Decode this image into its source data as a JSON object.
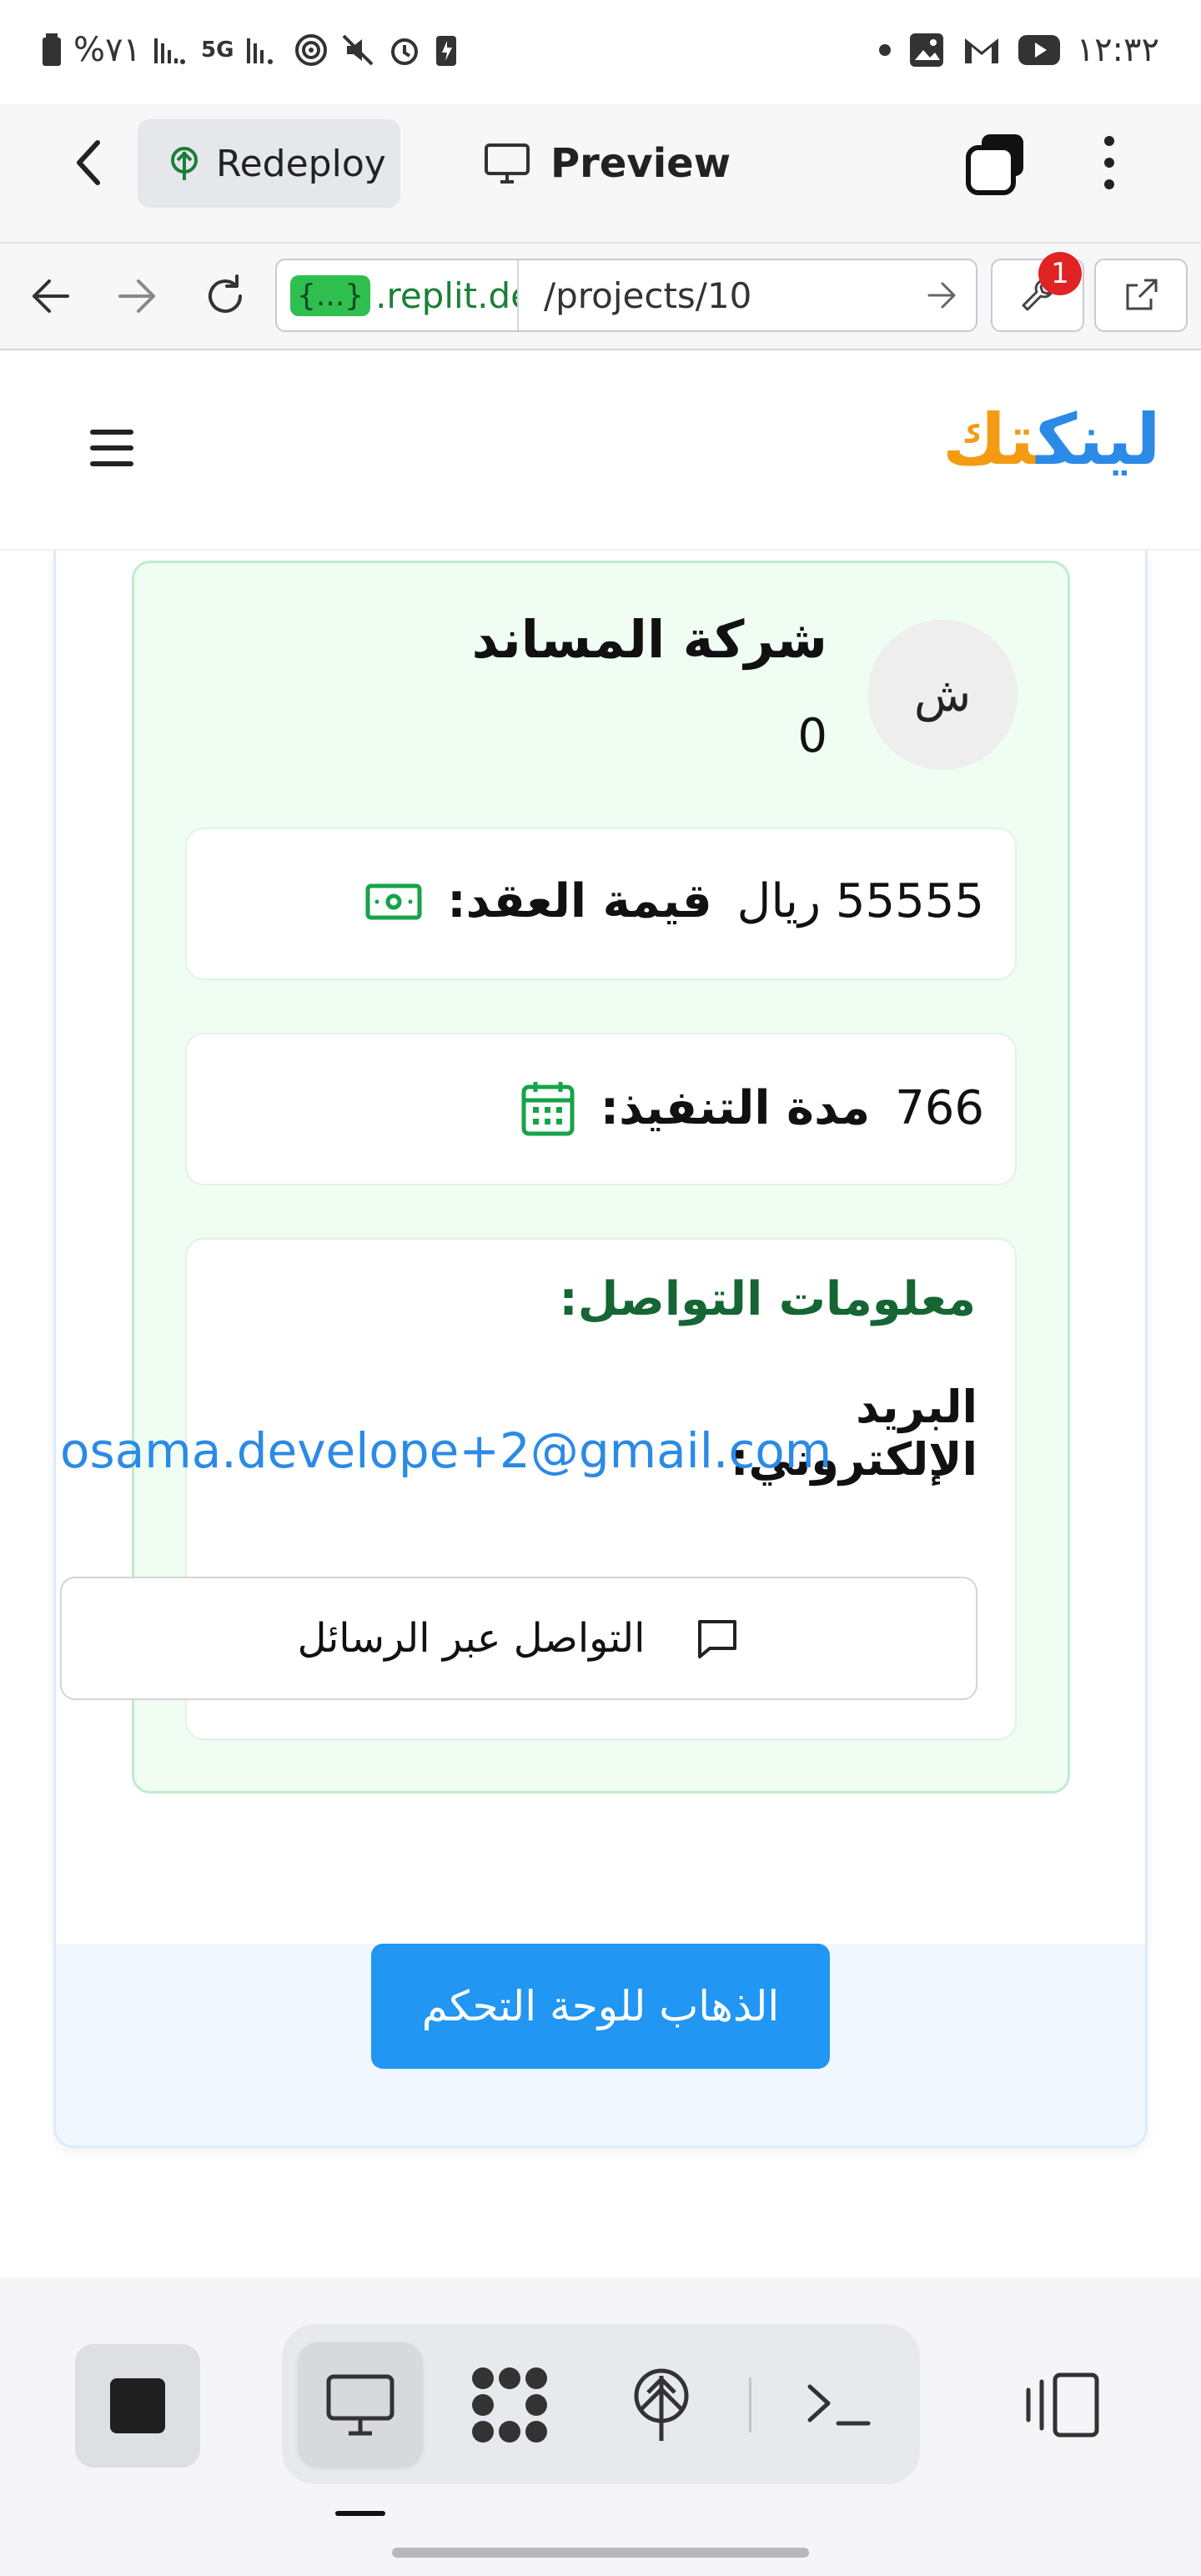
{
  "status_bar": {
    "battery": "%٧١",
    "network": "5G",
    "time": "١٢:٣٢"
  },
  "app_bar": {
    "redeploy_label": "Redeploy",
    "preview_label": "Preview"
  },
  "browser": {
    "url_badge": "{...}",
    "url_domain": ".replit.de",
    "url_path": "/projects/10",
    "notification_count": "1"
  },
  "site": {
    "logo_part1": "لينك",
    "logo_part2": "تك"
  },
  "company": {
    "avatar_letter": "ش",
    "name": "شركة المساند",
    "count": "0",
    "contract_value_label": "قيمة العقد:",
    "contract_value": "55555 ريال",
    "duration_label": "مدة التنفيذ:",
    "duration": "766",
    "contact_title": "معلومات التواصل:",
    "email_label": "البريد الإلكتروني:",
    "email": "osama.develope+2@gmail.com",
    "message_button": "التواصل عبر الرسائل"
  },
  "dashboard_button": "الذهاب للوحة التحكم",
  "colors": {
    "accent_green": "#16a34a",
    "link_blue": "#2b8ae6",
    "button_blue": "#2196f3",
    "logo_orange": "#f39c12"
  }
}
